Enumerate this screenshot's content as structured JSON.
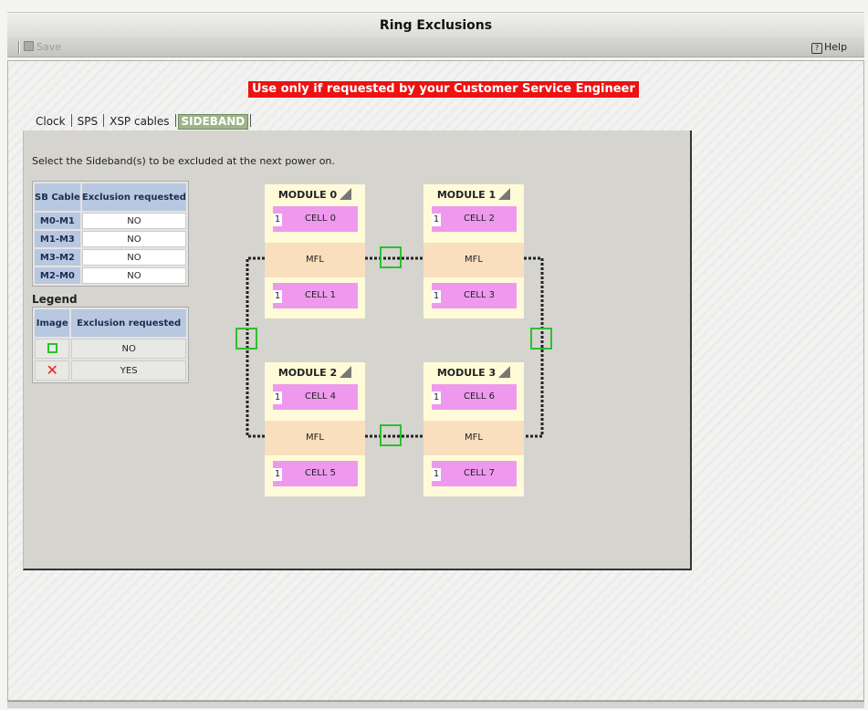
{
  "window": {
    "title": "Ring Exclusions"
  },
  "toolbar": {
    "save_label": "Save",
    "help_label": "Help",
    "help_glyph": "?"
  },
  "warning": "Use only if requested by your Customer Service Engineer",
  "tabs": [
    {
      "label": "Clock"
    },
    {
      "label": "SPS"
    },
    {
      "label": "XSP cables"
    },
    {
      "label": "SIDEBAND"
    }
  ],
  "instruction": "Select the Sideband(s) to be excluded at the next power on.",
  "sb_table": {
    "headers": [
      "SB Cable",
      "Exclusion requested"
    ],
    "rows": [
      {
        "cable": "M0-M1",
        "exclusion": "NO"
      },
      {
        "cable": "M1-M3",
        "exclusion": "NO"
      },
      {
        "cable": "M3-M2",
        "exclusion": "NO"
      },
      {
        "cable": "M2-M0",
        "exclusion": "NO"
      }
    ]
  },
  "legend": {
    "title": "Legend",
    "headers": [
      "Image",
      "Exclusion requested"
    ],
    "rows": [
      {
        "icon": "green-square-icon",
        "exclusion": "NO"
      },
      {
        "icon": "red-x-icon",
        "glyph": "✕",
        "exclusion": "YES"
      }
    ]
  },
  "modules": [
    {
      "name": "MODULE 0",
      "cells": [
        {
          "num": "1",
          "label": "CELL 0"
        },
        {
          "num": "1",
          "label": "CELL 1"
        }
      ],
      "mfl": "MFL"
    },
    {
      "name": "MODULE 1",
      "cells": [
        {
          "num": "1",
          "label": "CELL 2"
        },
        {
          "num": "1",
          "label": "CELL 3"
        }
      ],
      "mfl": "MFL"
    },
    {
      "name": "MODULE 2",
      "cells": [
        {
          "num": "1",
          "label": "CELL 4"
        },
        {
          "num": "1",
          "label": "CELL 5"
        }
      ],
      "mfl": "MFL"
    },
    {
      "name": "MODULE 3",
      "cells": [
        {
          "num": "1",
          "label": "CELL 6"
        },
        {
          "num": "1",
          "label": "CELL 7"
        }
      ],
      "mfl": "MFL"
    }
  ],
  "colors": {
    "warning_bg": "#ee1111",
    "tab_active": "#9db489",
    "link_ok": "#2cc02c",
    "cell": "#ee99ee",
    "mfl": "#f9dfbe",
    "module_bg": "#fffbd8",
    "header_bg": "#b8c8e0"
  }
}
